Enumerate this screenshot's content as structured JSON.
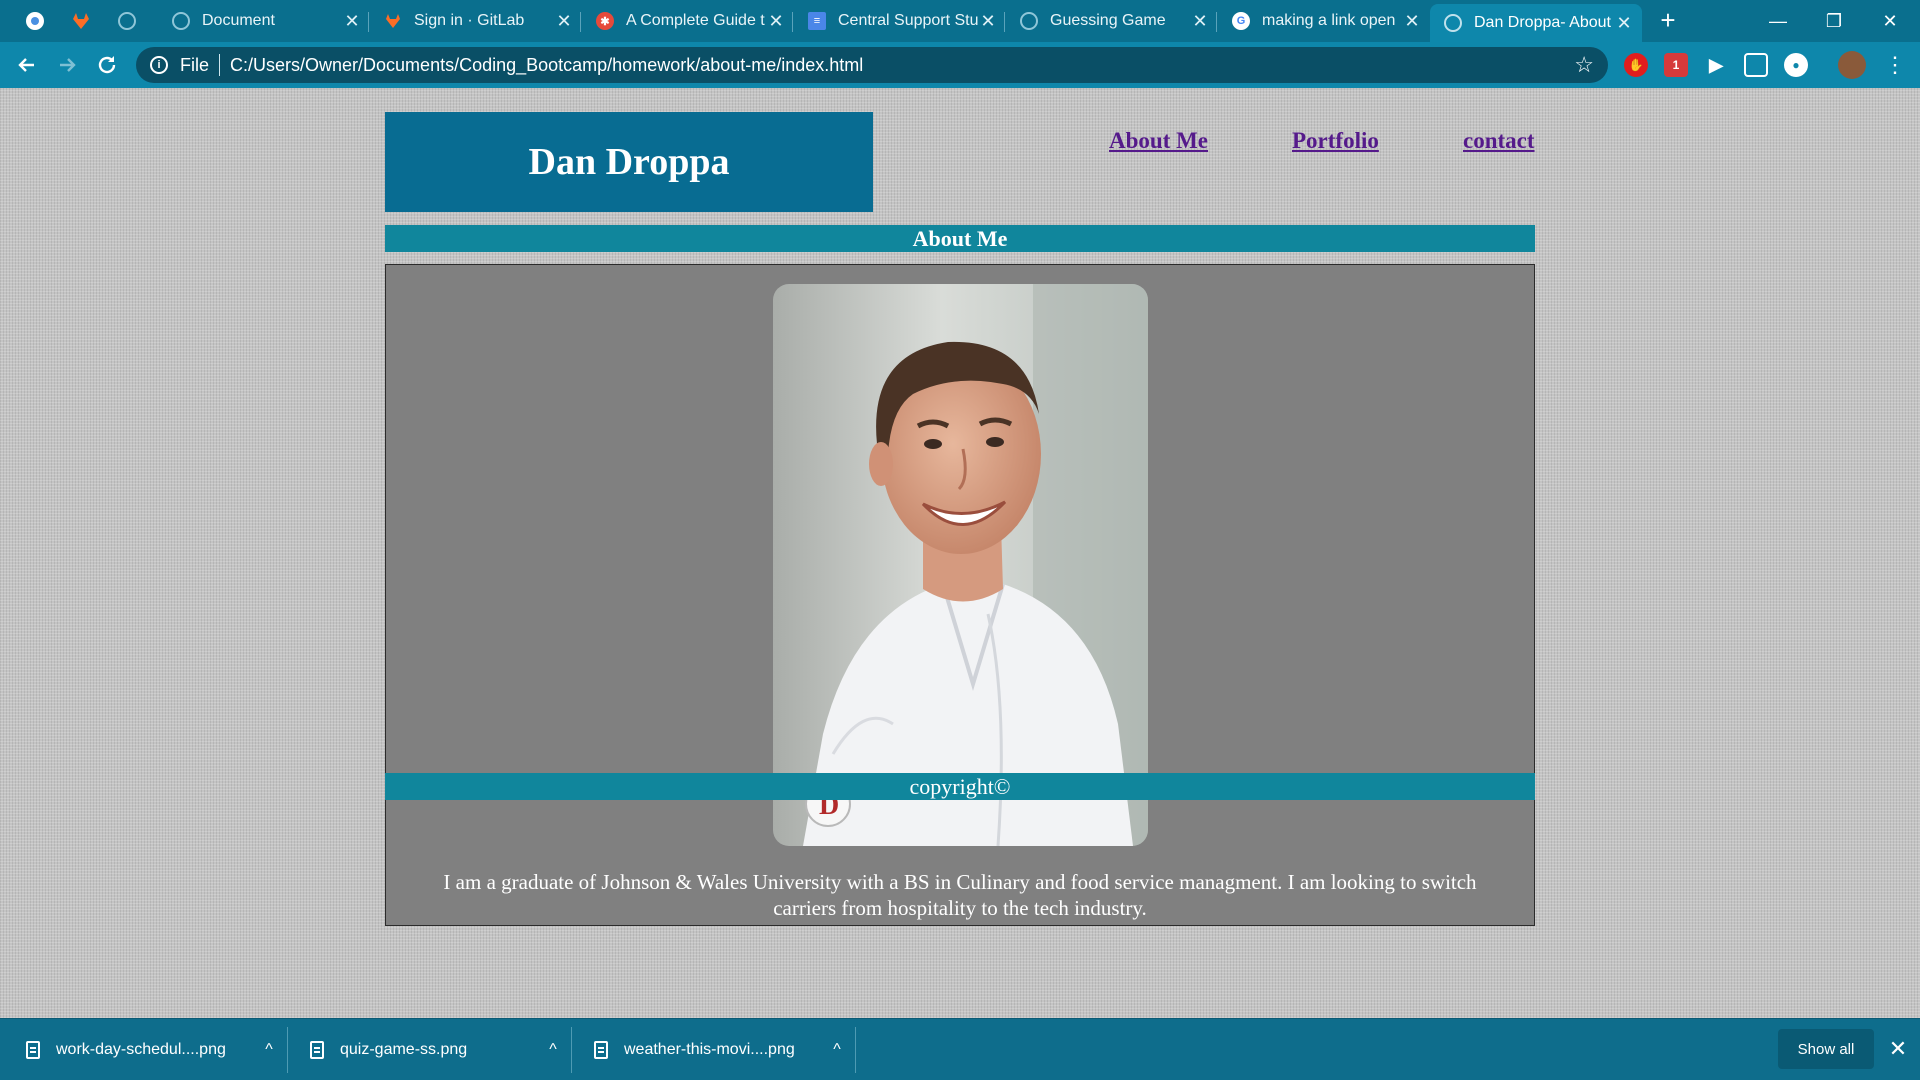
{
  "browser": {
    "tabs": [
      {
        "title": "Document",
        "icon": "globe-icon",
        "active": false
      },
      {
        "title": "Sign in · GitLab",
        "icon": "gitlab-icon",
        "active": false
      },
      {
        "title": "A Complete Guide t",
        "icon": "css-tricks-icon",
        "active": false
      },
      {
        "title": "Central Support Stu",
        "icon": "docs-icon",
        "active": false
      },
      {
        "title": "Guessing Game",
        "icon": "globe-icon",
        "active": false
      },
      {
        "title": "making a link open",
        "icon": "google-icon",
        "active": false
      },
      {
        "title": "Dan Droppa- About",
        "icon": "globe-icon",
        "active": true
      }
    ],
    "address": {
      "scheme": "File",
      "url": "C:/Users/Owner/Documents/Coding_Bootcamp/homework/about-me/index.html"
    },
    "extensions_badge": "1"
  },
  "page": {
    "site_title": "Dan Droppa",
    "nav": [
      "About Me",
      "Portfolio",
      "contact"
    ],
    "section_title": "About Me",
    "bio": "I am a graduate of Johnson & Wales University with a BS in Culinary and food service managment. I am looking to switch carriers from hospitality to the tech industry.",
    "photo_alt": "portrait of man in chef coat",
    "footer": "copyright©"
  },
  "downloads": {
    "items": [
      {
        "name": "work-day-schedul....png"
      },
      {
        "name": "quiz-game-ss.png"
      },
      {
        "name": "weather-this-movi....png"
      }
    ],
    "show_all": "Show all"
  },
  "colors": {
    "tab_strip": "#0a6f8e",
    "toolbar": "#0e87ab",
    "header_bg": "#086c92",
    "section_bar": "#10869c",
    "content_bg": "#808080",
    "link_visited": "#551a8b"
  }
}
